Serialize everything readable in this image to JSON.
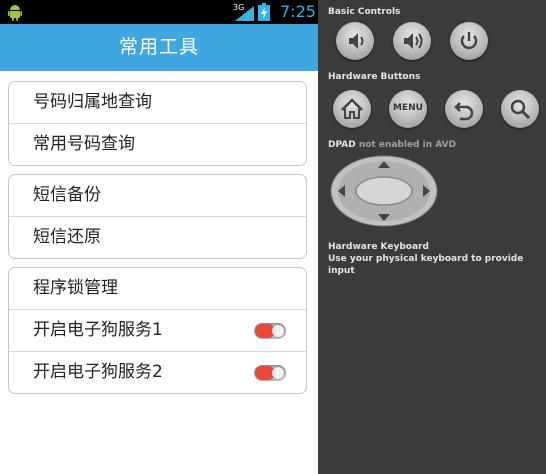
{
  "status_bar": {
    "network": "3G",
    "time": "7:25",
    "icons": [
      "android-icon",
      "signal-icon",
      "battery-icon"
    ]
  },
  "app": {
    "title": "常用工具",
    "groups": [
      {
        "items": [
          {
            "label": "号码归属地查询"
          },
          {
            "label": "常用号码查询"
          }
        ]
      },
      {
        "items": [
          {
            "label": "短信备份"
          },
          {
            "label": "短信还原"
          }
        ]
      },
      {
        "items": [
          {
            "label": "程序锁管理"
          },
          {
            "label": "开启电子狗服务1",
            "toggle_on": true
          },
          {
            "label": "开启电子狗服务2",
            "toggle_on": true
          }
        ]
      }
    ]
  },
  "emulator": {
    "basic_controls_label": "Basic Controls",
    "basic_buttons": [
      "volume-down-icon",
      "volume-up-icon",
      "power-icon"
    ],
    "hardware_buttons_label": "Hardware Buttons",
    "hardware_buttons": [
      "home-icon",
      "menu-button",
      "back-icon",
      "search-icon"
    ],
    "menu_label": "MENU",
    "dpad_label_strong": "DPAD",
    "dpad_label_rest": " not enabled in AVD",
    "keyboard_title": "Hardware Keyboard",
    "keyboard_text": "Use your physical keyboard to provide input"
  },
  "colors": {
    "title_bar": "#3fa6df",
    "clock": "#35b5e5",
    "toggle_on": "#e8493a",
    "panel_bg": "#3b3b3b"
  }
}
